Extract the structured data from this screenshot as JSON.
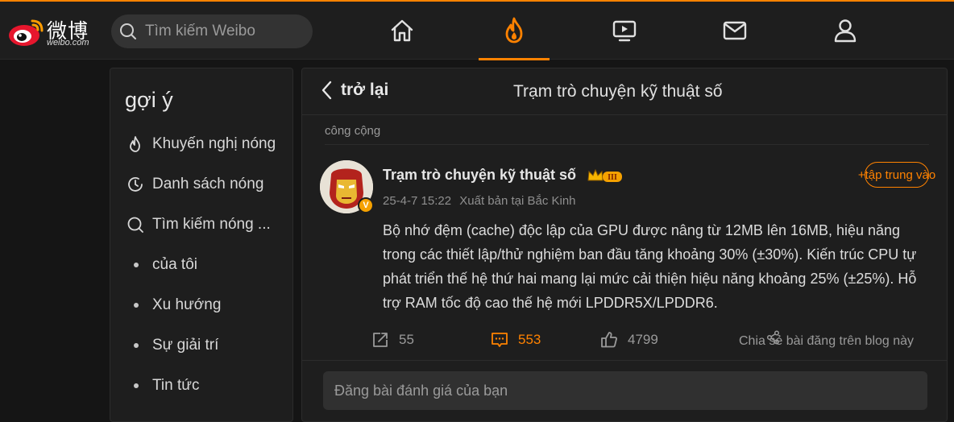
{
  "brand": {
    "name": "微博",
    "sub": "weibo.com",
    "accent": "#ff8200"
  },
  "search": {
    "placeholder": "Tìm kiếm Weibo",
    "icon": "search-icon"
  },
  "nav": [
    {
      "icon": "home-icon"
    },
    {
      "icon": "hot-flame-icon",
      "active": true
    },
    {
      "icon": "video-icon"
    },
    {
      "icon": "mail-icon"
    },
    {
      "icon": "profile-icon"
    }
  ],
  "sidebar": {
    "title": "gợi ý",
    "items": [
      {
        "label": "Khuyến nghị nóng",
        "icon": "flame-icon"
      },
      {
        "label": "Danh sách nóng",
        "icon": "clock-icon"
      },
      {
        "label": "Tìm kiếm nóng ...",
        "icon": "search-icon"
      },
      {
        "label": "của tôi",
        "icon": "dot"
      },
      {
        "label": "Xu hướng",
        "icon": "dot"
      },
      {
        "label": "Sự giải trí",
        "icon": "dot"
      },
      {
        "label": "Tin tức",
        "icon": "dot"
      }
    ]
  },
  "header": {
    "back_label": "trở lại",
    "title": "Trạm trò chuyện kỹ thuật số"
  },
  "post": {
    "visibility": "công cộng",
    "author": "Trạm trò chuyện kỹ thuật số",
    "badge_level": "III",
    "verified_mark": "V",
    "time": "25-4-7 15:22",
    "location": "Xuất bản tại Bắc Kinh",
    "follow_label": "+tập trung vào",
    "text": "Bộ nhớ đệm (cache) độc lập của GPU được nâng từ 12MB lên 16MB, hiệu năng trong các thiết lập/thử nghiệm ban đầu tăng khoảng 30% (±30%). Kiến trúc CPU tự phát triển thế hệ thứ hai mang lại mức cải thiện hiệu năng khoảng 25% (±25%). Hỗ trợ RAM tốc độ cao thế hệ mới LPDDR5X/LPDDR6.",
    "reposts": "55",
    "comments": "553",
    "likes": "4799",
    "share_blog_label": "Chia sẻ bài đăng trên blog này"
  },
  "comment_box": {
    "placeholder": "Đăng bài đánh giá của bạn"
  }
}
